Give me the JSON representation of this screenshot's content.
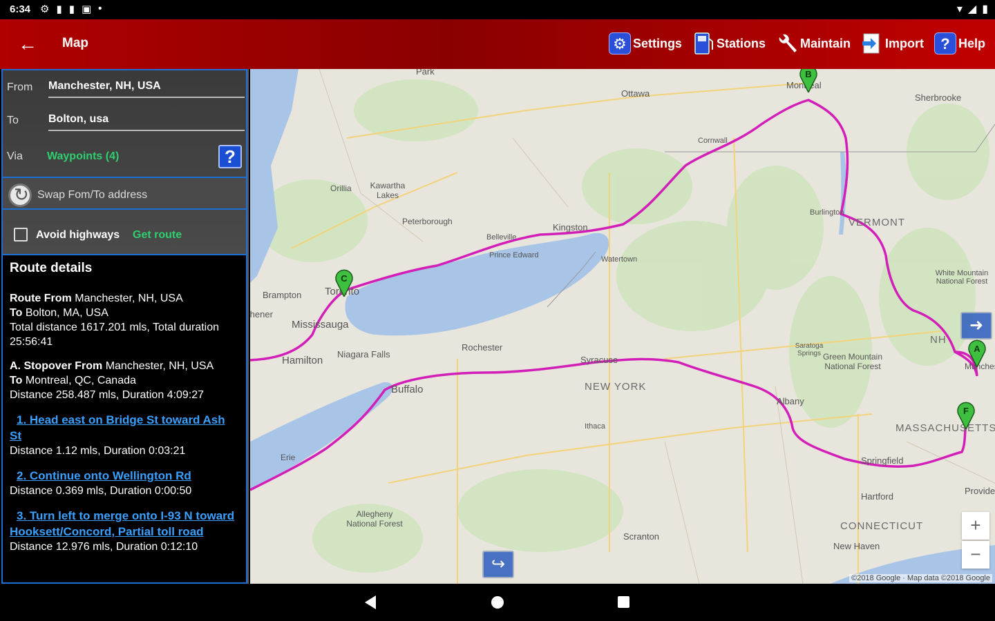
{
  "status": {
    "time": "6:34"
  },
  "appbar": {
    "title": "Map",
    "actions": [
      {
        "label": "Settings",
        "icon": "gear-icon"
      },
      {
        "label": "Stations",
        "icon": "fuel-pump-icon"
      },
      {
        "label": "Maintain",
        "icon": "wrench-icon"
      },
      {
        "label": "Import",
        "icon": "import-icon"
      },
      {
        "label": "Help",
        "icon": "question-icon"
      }
    ]
  },
  "form": {
    "from_label": "From",
    "from_value": "Manchester, NH, USA",
    "to_label": "To",
    "to_value": "Bolton, usa",
    "via_label": "Via",
    "via_value": "Waypoints (4)",
    "swap_label": "Swap Fom/To address",
    "avoid_label": "Avoid highways",
    "get_route": "Get route"
  },
  "details": {
    "title": "Route details",
    "route_from_label": "Route From",
    "route_from_value": "Manchester, NH, USA",
    "route_to_label": "To",
    "route_to_value": "Bolton, MA, USA",
    "total_line": "Total distance 1617.201 mls, Total duration 25:56:41",
    "stop_label": "A. Stopover From",
    "stop_from_value": "Manchester, NH, USA",
    "stop_to_label": "To",
    "stop_to_value": "Montreal, QC, Canada",
    "stop_dist": "Distance 258.487 mls, Duration 4:09:27",
    "steps": [
      {
        "title": "1. Head east on Bridge St toward Ash St",
        "dist": "Distance 1.12 mls, Duration 0:03:21"
      },
      {
        "title": "2. Continue onto Wellington Rd",
        "dist": "Distance 0.369 mls, Duration 0:00:50"
      },
      {
        "title": "3. Turn left to merge onto I-93 N toward Hooksett/Concord, Partial toll road",
        "dist": "Distance 12.976 mls, Duration 0:12:10"
      }
    ]
  },
  "map": {
    "labels": {
      "ottawa": "Ottawa",
      "montreal": "Montreal",
      "sherbrooke": "Sherbrooke",
      "cornwall": "Cornwall",
      "kawartha": "Kawartha Lakes",
      "orillia": "Orillia",
      "peterborough": "Peterborough",
      "kingston": "Kingston",
      "belleville": "Belleville",
      "prince_edward": "Prince Edward",
      "watertown": "Watertown",
      "burlington": "Burlington",
      "vermont": "VERMONT",
      "white_mountain": "White Mountain National Forest",
      "brampton": "Brampton",
      "toronto": "Toronto",
      "kitchener": "Kitchener",
      "mississauga": "Mississauga",
      "hamilton": "Hamilton",
      "niagara": "Niagara Falls",
      "rochester": "Rochester",
      "syracuse": "Syracuse",
      "new_york": "NEW YORK",
      "saratoga": "Saratoga Springs",
      "green_mountain": "Green Mountain National Forest",
      "albany": "Albany",
      "buffalo": "Buffalo",
      "erie": "Erie",
      "ithaca": "Ithaca",
      "massachusetts": "MASSACHUSETTS",
      "springfield": "Springfield",
      "hartford": "Hartford",
      "providence": "Providence",
      "allegheny": "Allegheny National Forest",
      "scranton": "Scranton",
      "connecticut": "CONNECTICUT",
      "new_haven": "New Haven",
      "manchester": "Manchester",
      "nh": "NH",
      "park": "Park"
    },
    "pins": [
      "A",
      "B",
      "C",
      "F"
    ],
    "attribution": "©2018 Google · Map data ©2018 Google",
    "zoom_in": "+",
    "zoom_out": "−",
    "route_color": "#d21fb8",
    "water_color": "#a8c4e6",
    "land_color": "#e8e5dc",
    "forest_color": "#cfe3bf"
  }
}
